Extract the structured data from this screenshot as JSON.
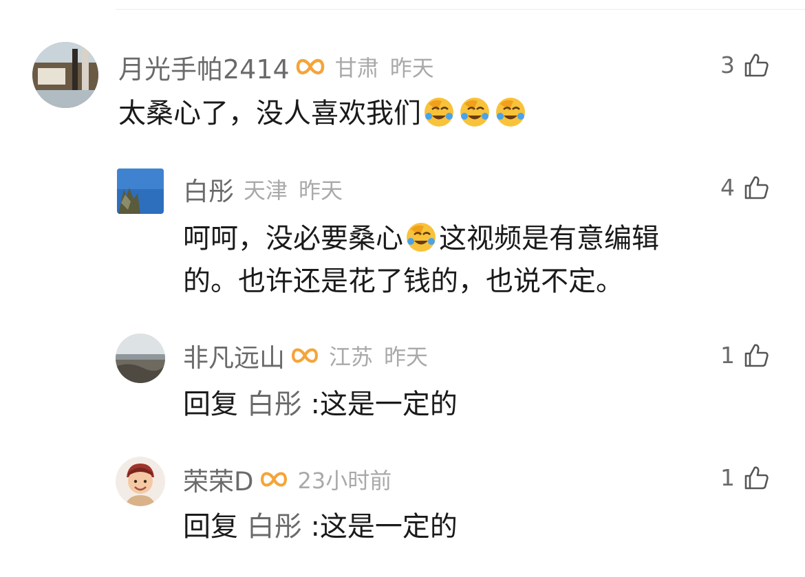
{
  "comments": [
    {
      "username": "月光手帕2414",
      "location": "甘肃",
      "time": "昨天",
      "likes": "3",
      "has_badge": true,
      "text": "太桑心了，没人喜欢我们",
      "emojis": [
        "laugh-cry-emoji",
        "laugh-cry-emoji",
        "laugh-cry-emoji"
      ]
    },
    {
      "username": "白彤",
      "location": "天津",
      "time": "昨天",
      "likes": "4",
      "has_badge": false,
      "text_part1": "呵呵，没必要桑心",
      "text_part2": "这视频是有意编辑",
      "text_line2": "的。也许还是花了钱的，也说不定。",
      "emojis": [
        "laugh-cry-emoji"
      ]
    },
    {
      "username": "非凡远山",
      "location": "江苏",
      "time": "昨天",
      "likes": "1",
      "has_badge": true,
      "reply_prefix": "回复",
      "reply_to": "白彤",
      "text": ":这是一定的"
    },
    {
      "username": "荣荣D",
      "time": "23小时前",
      "likes": "1",
      "has_badge": true,
      "reply_prefix": "回复",
      "reply_to": "白彤",
      "text": ":这是一定的"
    }
  ],
  "colors": {
    "badge": "#f5a43a",
    "username": "#6a6a6a",
    "meta": "#a9a9a9",
    "text": "#1a1a1a"
  },
  "icons": {
    "like": "thumbs-up-outline-icon",
    "badge": "infinity-vip-badge-icon"
  }
}
